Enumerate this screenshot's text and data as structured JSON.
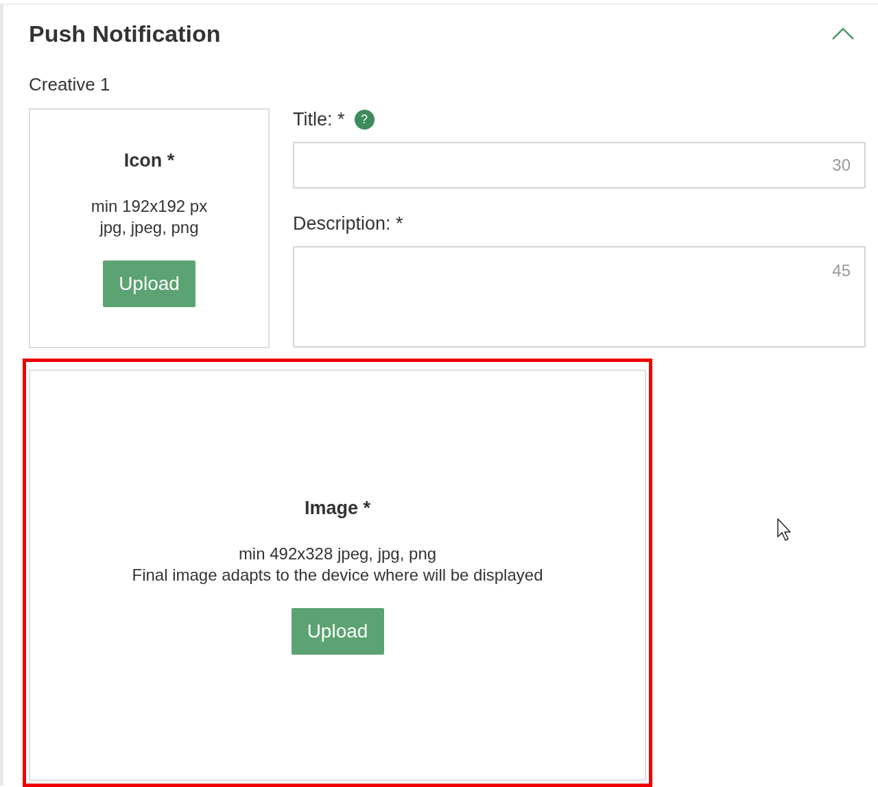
{
  "section": {
    "title": "Push Notification",
    "expanded": true
  },
  "creative_label": "Creative 1",
  "icon_upload": {
    "title": "Icon *",
    "hints": [
      "min 192x192 px",
      "jpg, jpeg, png"
    ],
    "button": "Upload"
  },
  "fields": [
    {
      "kind": "input",
      "label": "Title: *",
      "help": "?",
      "counter": "30"
    },
    {
      "kind": "textarea",
      "label": "Description: *",
      "counter": "45"
    }
  ],
  "image_upload": {
    "title": "Image *",
    "hints": [
      "min 492x328 jpeg, jpg, png",
      "Final image adapts to the device where will be displayed"
    ],
    "button": "Upload",
    "highlighted": true
  }
}
